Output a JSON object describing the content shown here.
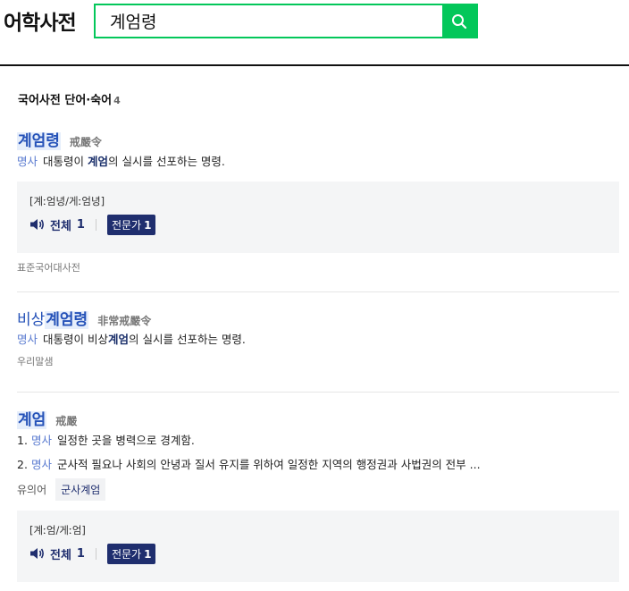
{
  "header": {
    "logo": "어학사전",
    "search_value": "계엄령"
  },
  "section": {
    "title": "국어사전 단어·숙어",
    "count": "4"
  },
  "entries": [
    {
      "headword_hl": "계엄령",
      "hanja": "戒嚴令",
      "def_pos": "명사",
      "def_pre": "대통령이 ",
      "def_bold": "계엄",
      "def_post": "의 실시를 선포하는 명령.",
      "pron": "[계ː엄녕/게ː엄녕]",
      "audio_label": "전체",
      "audio_count": "1",
      "pro_label": "전문가",
      "pro_count": "1",
      "source": "표준국어대사전"
    },
    {
      "headword_pre": "비상",
      "headword_hl": "계엄령",
      "hanja": "非常戒嚴令",
      "def_pos": "명사",
      "def_pre": "대통령이 비상",
      "def_bold": "계엄",
      "def_post": "의 실시를 선포하는 명령.",
      "source": "우리말샘"
    },
    {
      "headword_hl": "계엄",
      "hanja": "戒嚴",
      "defs": [
        {
          "num": "1.",
          "pos": "명사",
          "text": "일정한 곳을 병력으로 경계함."
        },
        {
          "num": "2.",
          "pos": "명사",
          "text": "군사적 필요나 사회의 안녕과 질서 유지를 위하여 일정한 지역의 행정권과 사법권의 전부 ..."
        }
      ],
      "synonym_label": "유의어",
      "synonym": "군사계엄",
      "pron": "[계ː엄/게ː엄]",
      "audio_label": "전체",
      "audio_count": "1",
      "pro_label": "전문가",
      "pro_count": "1"
    }
  ],
  "icons": {
    "search": "search-icon",
    "speaker": "speaker-icon"
  },
  "colors": {
    "accent": "#03c75a",
    "headword": "#2552b8",
    "badge": "#1f2e6e"
  }
}
